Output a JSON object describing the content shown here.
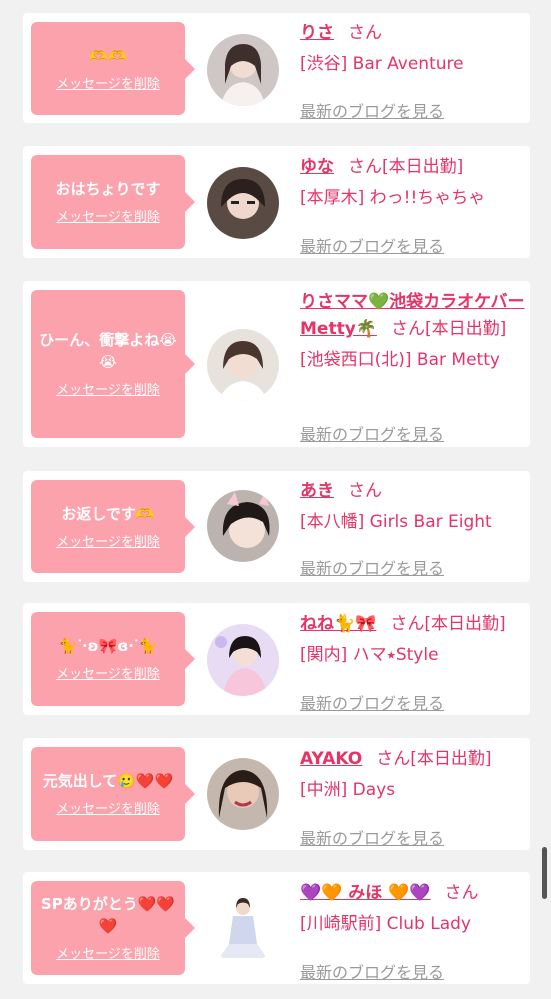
{
  "delete_label": "メッセージを削除",
  "san": "さん",
  "blog_label": "最新のブログを見る",
  "cards": [
    {
      "message": "🫶🫶",
      "name": "りさ",
      "suffix": "さん",
      "shop": "[渋谷] Bar Aventure"
    },
    {
      "message": "おはちょりです",
      "name": "ゆな",
      "suffix": "さん[本日出勤]",
      "shop": "[本厚木] わっ!!ちゃちゃ"
    },
    {
      "message": "ひーん、衝撃よね😭😭",
      "name": "りさママ💚池袋カラオケバーMetty🌴",
      "suffix": "さん[本日出勤]",
      "shop": "[池袋西口(北)] Bar Metty"
    },
    {
      "message": "お返しです🫶",
      "name": "あき",
      "suffix": "さん",
      "shop": "[本八幡] Girls Bar Eight"
    },
    {
      "message": "🐈ᐝ·ʚ🎀ɞ·ᐝ🐈",
      "name": "ねね🐈🎀",
      "suffix": "さん[本日出勤]",
      "shop": "[関内] ハマ⭑Style"
    },
    {
      "message": "元気出して🥲❤️❤️",
      "name": "AYAKO",
      "suffix": "さん[本日出勤]",
      "shop": "[中洲] Days"
    },
    {
      "message": "SPありがとう❤️❤️❤️",
      "name": "💜🧡 みほ 🧡💜",
      "suffix": "さん",
      "shop": "[川崎駅前] Club Lady"
    }
  ],
  "colors": {
    "accent": "#e63467",
    "bubble": "#fca2ad",
    "muted": "#9a9a9a",
    "background": "#f1f1f1"
  },
  "icons": [
    "avatar-photo"
  ]
}
